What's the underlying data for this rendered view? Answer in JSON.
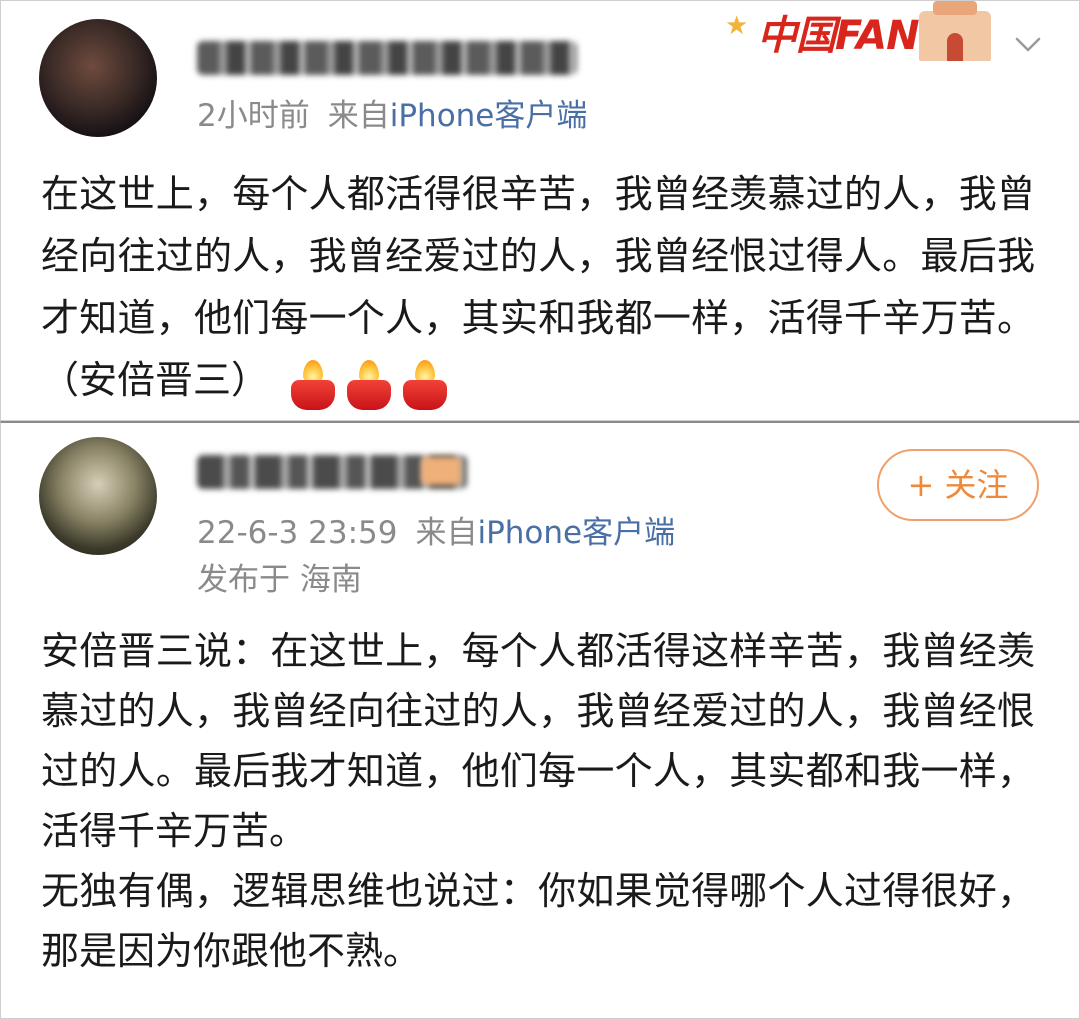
{
  "post1": {
    "time": "2小时前",
    "from_label": "来自",
    "source": "iPhone客户端",
    "badge_text": "中国FANS",
    "text": "在这世上，每个人都活得很辛苦，我曾经羡慕过的人，我曾经向往过的人，我曾经爱过的人，我曾经恨过得人。最后我才知道，他们每一个人，其实和我都一样，活得千辛万苦。（安倍晋三）"
  },
  "post2": {
    "time": "22-6-3 23:59",
    "from_label": "来自",
    "source": "iPhone客户端",
    "location": "发布于 海南",
    "follow_label": "+ 关注",
    "paragraph1": "安倍晋三说：在这世上，每个人都活得这样辛苦，我曾经羡慕过的人，我曾经向往过的人，我曾经爱过的人，我曾经恨过的人。最后我才知道，他们每一个人，其实都和我一样，活得千辛万苦。",
    "paragraph2": "无独有偶，逻辑思维也说过：你如果觉得哪个人过得很好，那是因为你跟他不熟。"
  },
  "colors": {
    "source_link": "#4a6fa5",
    "follow_accent": "#f0883a",
    "badge_red": "#d8261c"
  },
  "icons": [
    "chevron-down-icon",
    "candle-emoji-icon"
  ]
}
